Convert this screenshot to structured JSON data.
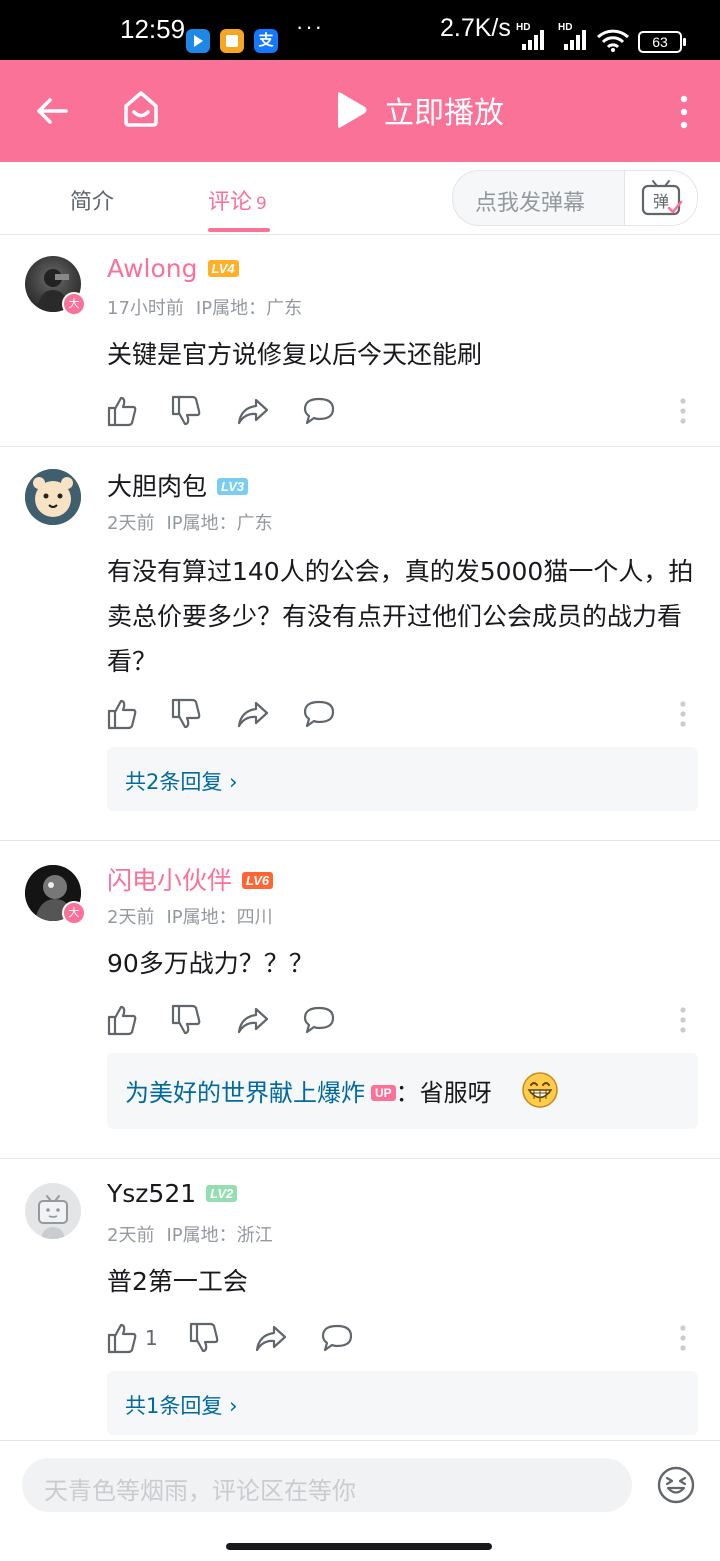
{
  "status_bar": {
    "time": "12:59",
    "network_speed": "2.7K/s",
    "battery": "63",
    "more": "···",
    "app_icons": [
      {
        "name": "messenger-app-icon",
        "color": "#1e88e5"
      },
      {
        "name": "notes-app-icon",
        "color": "#f5a623"
      },
      {
        "name": "alipay-app-icon",
        "glyph": "支",
        "color": "#1677ff"
      }
    ]
  },
  "top_bar": {
    "play_label": "立即播放",
    "background": "#fb7299"
  },
  "tabs": [
    {
      "label": "简介",
      "active": false
    },
    {
      "label": "评论",
      "count": "9",
      "active": true
    }
  ],
  "danmaku": {
    "placeholder": "点我发弹幕",
    "button_glyph": "弹"
  },
  "vip_badge_glyph": "大",
  "comments": [
    {
      "username": "Awlong",
      "vip": true,
      "level": "LV4",
      "level_color": "#ffb027",
      "time": "17小时前",
      "ip": "IP属地：广东",
      "content": "关键是官方说修复以后今天还能刷",
      "likes": "",
      "replies": null
    },
    {
      "username": "大胆肉包",
      "vip": false,
      "level": "LV3",
      "level_color": "#7bcdef",
      "time": "2天前",
      "ip": "IP属地：广东",
      "content": "有没有算过140人的公会，真的发5000猫一个人，拍卖总价要多少？有没有点开过他们公会成员的战力看看？",
      "likes": "",
      "replies": "共2条回复"
    },
    {
      "username": "闪电小伙伴",
      "vip": true,
      "level": "LV6",
      "level_color": "#ff6633",
      "time": "2天前",
      "ip": "IP属地：四川",
      "content": "90多万战力？？？",
      "likes": "",
      "replies": null,
      "sub_reply": {
        "author": "为美好的世界献上爆炸",
        "tag": "UP",
        "text": "：省服呀"
      }
    },
    {
      "username": "Ysz521",
      "vip": false,
      "level": "LV2",
      "level_color": "#95ddb2",
      "time": "2天前",
      "ip": "IP属地：浙江",
      "content": "普2第一工会",
      "likes": "1",
      "replies": "共1条回复"
    }
  ],
  "bottom_bar": {
    "placeholder": "天青色等烟雨，评论区在等你"
  }
}
